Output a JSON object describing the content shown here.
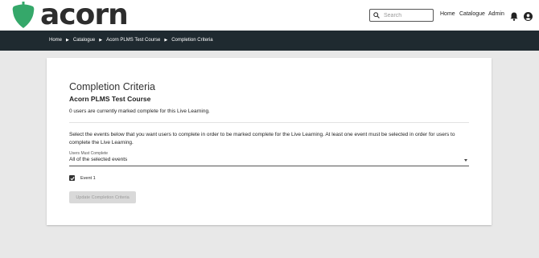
{
  "header": {
    "logo_text": "acorn",
    "search": {
      "placeholder": "Search"
    },
    "nav": {
      "home": "Home",
      "catalogue": "Catalogue",
      "admin": "Admin"
    }
  },
  "breadcrumb": [
    "Home",
    "Catalogue",
    "Acorn PLMS Test Course",
    "Completion Criteria"
  ],
  "main": {
    "title": "Completion Criteria",
    "subtitle": "Acorn PLMS Test Course",
    "count_text": "0 users are currently marked complete for this Live Learning.",
    "instructions": "Select the events below that you want users to complete in order to be marked complete for the Live Learning. At least one event must be selected in order for users to complete the Live Learning.",
    "select": {
      "label": "Users Must Complete",
      "value": "All of the selected events"
    },
    "events": [
      {
        "label": "Event 1",
        "checked": true
      }
    ],
    "submit_label": "Update Completion Criteria"
  },
  "colors": {
    "brand_green": "#35a86a",
    "breadcrumb_bg": "#1f2a30",
    "page_bg": "#e8e8e8"
  }
}
